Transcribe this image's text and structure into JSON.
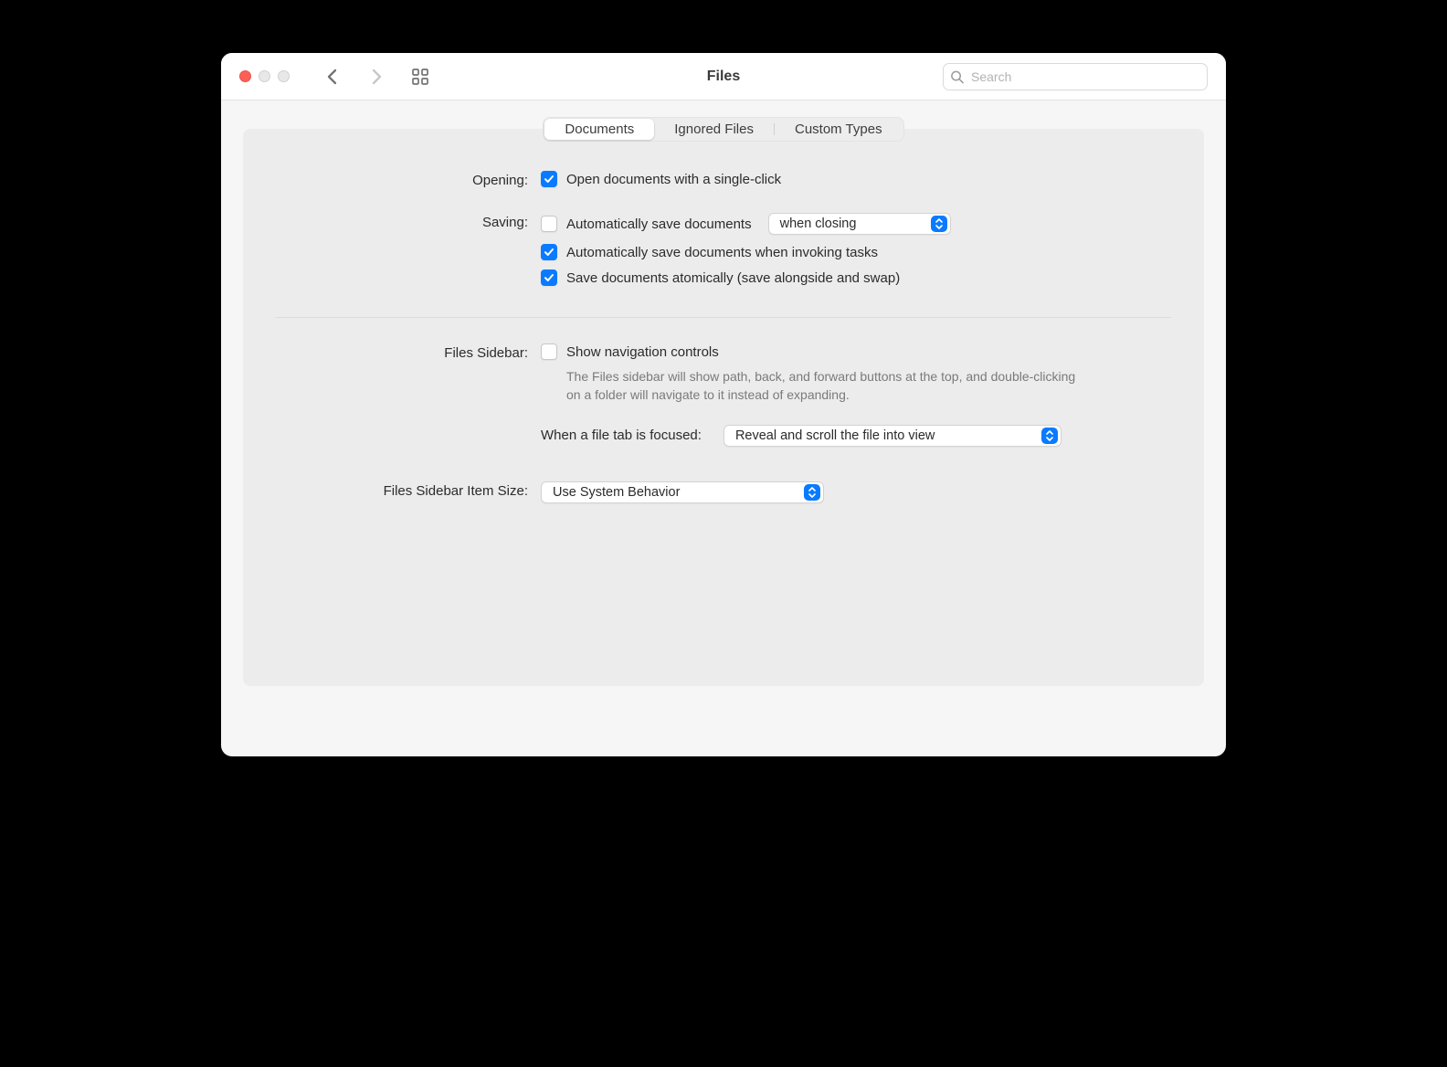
{
  "window": {
    "title": "Files",
    "search_placeholder": "Search"
  },
  "tabs": {
    "documents": "Documents",
    "ignored_files": "Ignored Files",
    "custom_types": "Custom Types"
  },
  "opening": {
    "label": "Opening:",
    "single_click": "Open documents with a single-click"
  },
  "saving": {
    "label": "Saving:",
    "auto_save": "Automatically save documents",
    "auto_save_when_value": "when closing",
    "auto_save_invoking_tasks": "Automatically save documents when invoking tasks",
    "save_atomically": "Save documents atomically (save alongside and swap)"
  },
  "files_sidebar": {
    "label": "Files Sidebar:",
    "show_nav": "Show navigation controls",
    "help": "The Files sidebar will show path, back, and forward buttons at the top, and double-clicking on a folder will navigate to it instead of expanding.",
    "focused_label": "When a file tab is focused:",
    "focused_value": "Reveal and scroll the file into view"
  },
  "item_size": {
    "label": "Files Sidebar Item Size:",
    "value": "Use System Behavior"
  }
}
